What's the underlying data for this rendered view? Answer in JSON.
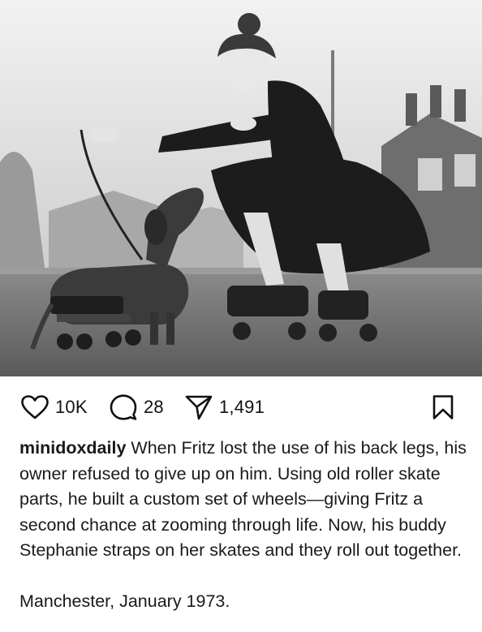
{
  "post": {
    "image_alt_icon": "photo-image"
  },
  "actions": {
    "likes": "10K",
    "comments": "28",
    "shares": "1,491"
  },
  "caption": {
    "username": "minidoxdaily",
    "text": "When Fritz lost the use of his back legs, his owner refused to give up on him. Using old roller skate parts, he built a custom set of wheels—giving Fritz a second chance at zooming through life. Now, his buddy Stephanie straps on her skates and they roll out together.",
    "location_date": "Manchester, January 1973."
  },
  "icons": {
    "like": "heart-icon",
    "comment": "comment-bubble-icon",
    "share": "paper-plane-icon",
    "save": "bookmark-icon"
  }
}
